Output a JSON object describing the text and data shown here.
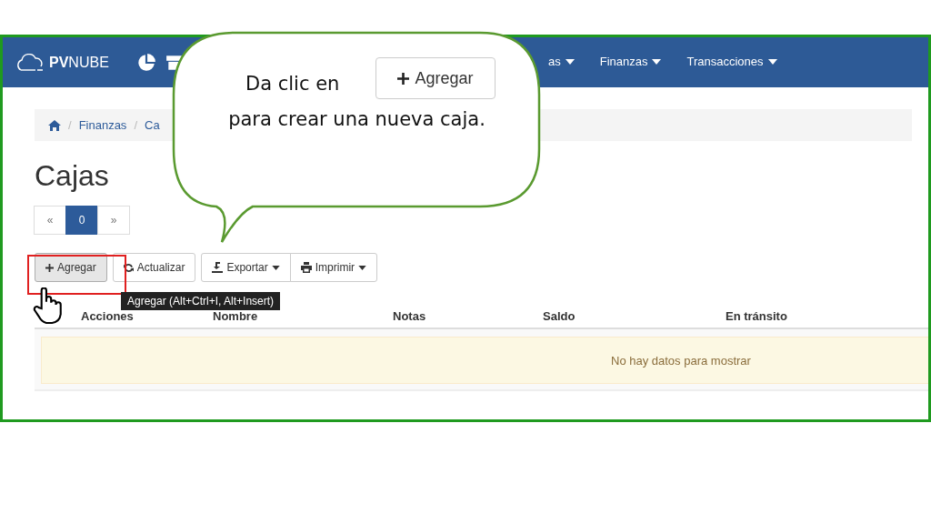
{
  "navbar": {
    "logo": "**PV**NUBE",
    "menus": [
      {
        "label": "as"
      },
      {
        "label": "Finanzas"
      },
      {
        "label": "Transacciones"
      }
    ]
  },
  "breadcrumb": {
    "separator": "/",
    "items": [
      "Finanzas",
      "Ca"
    ]
  },
  "page_title": "Cajas",
  "pagination": [
    {
      "label": "«",
      "selected": false
    },
    {
      "label": "0",
      "selected": true
    },
    {
      "label": "»",
      "selected": false
    }
  ],
  "toolbar": [
    {
      "label": "Agregar",
      "kind": "plus",
      "caret": false,
      "selected": true
    },
    {
      "label": "Actualizar",
      "kind": "refresh",
      "caret": false,
      "selected": false
    },
    {
      "label": "Exportar",
      "kind": "export",
      "caret": true,
      "selected": false
    },
    {
      "label": "Imprimir",
      "kind": "print",
      "caret": true,
      "selected": false
    }
  ],
  "tooltip": "Agregar (Alt+Ctrl+I, Alt+Insert)",
  "table": {
    "columns": [
      "Acciones",
      "Nombre",
      "Notas",
      "Saldo",
      "En tránsito"
    ],
    "empty_message": "No hay datos para mostrar"
  },
  "callout": {
    "text_before": "Da clic en",
    "button": "Agregar",
    "text_after": "para crear una nueva caja."
  }
}
